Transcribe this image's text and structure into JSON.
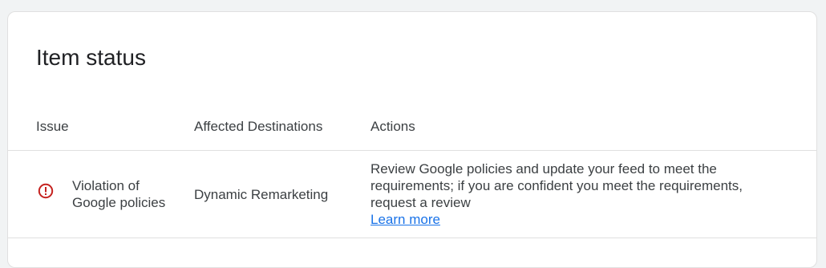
{
  "card": {
    "title": "Item status"
  },
  "table": {
    "columns": [
      "Issue",
      "Affected Destinations",
      "Actions"
    ],
    "rows": [
      {
        "status_icon": "error-alert-icon",
        "issue": "Violation of Google policies",
        "destination": "Dynamic Remarketing",
        "action_text": "Review Google policies and update your feed to meet the requirements; if you are confident you meet the requirements, request a review",
        "action_link": "Learn more"
      }
    ]
  },
  "colors": {
    "error": "#c5221f",
    "link": "#1a73e8",
    "text": "#3c4043",
    "divider": "#e0e0e0"
  }
}
